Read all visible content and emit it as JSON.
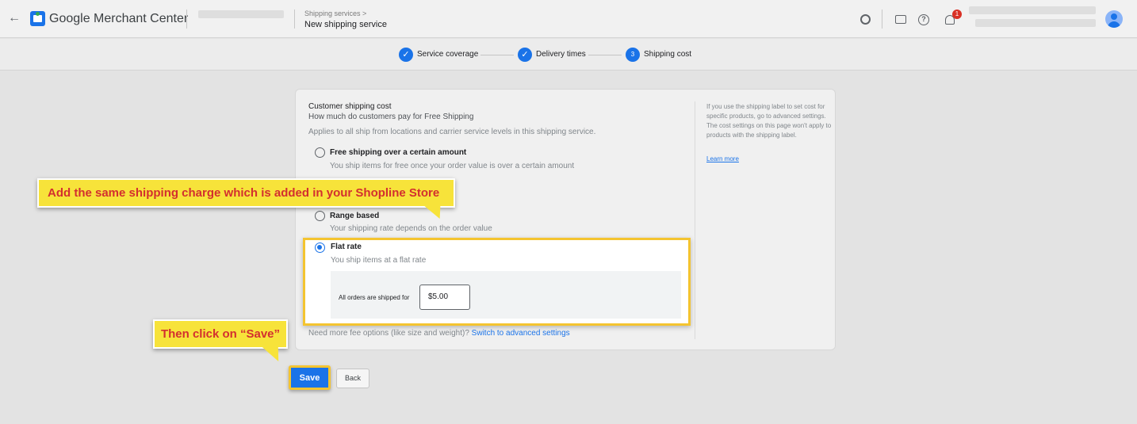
{
  "header": {
    "app_title": "Google Merchant Center",
    "breadcrumb_parent": "Shipping services >",
    "page_title": "New shipping service",
    "notification_count": "1",
    "icons": [
      "back-arrow-icon",
      "merchant-center-logo-icon",
      "settings-gear-icon",
      "mail-icon",
      "help-icon",
      "notifications-bell-icon",
      "account-avatar-icon"
    ]
  },
  "stepper": {
    "steps": [
      {
        "label": "Service coverage",
        "state": "done",
        "marker": "✓"
      },
      {
        "label": "Delivery times",
        "state": "done",
        "marker": "✓"
      },
      {
        "label": "Shipping cost",
        "state": "current",
        "marker": "3"
      }
    ]
  },
  "form": {
    "title": "Customer shipping cost",
    "subtitle": "How much do customers pay for Free Shipping",
    "note": "Applies to all ship from locations and carrier service levels in this shipping service.",
    "options": [
      {
        "label": "Free shipping over a certain amount",
        "description": "You ship items for free once your order value is over a certain amount",
        "selected": false
      },
      {
        "label": "Range based",
        "description": "Your shipping rate depends on the order value",
        "selected": false
      },
      {
        "label": "Flat rate",
        "description": "You ship items at a flat rate",
        "selected": true
      }
    ],
    "flat_rate_prompt": "All orders are shipped for",
    "flat_rate_value": "$5.00",
    "more_fee_text": "Need more fee options (like size and weight)? ",
    "more_fee_link": "Switch to advanced settings"
  },
  "side_note": {
    "text": "If you use the shipping label to set cost for specific products, go to advanced settings. The cost settings on this page won't apply to products with the shipping label.",
    "link": "Learn more"
  },
  "buttons": {
    "save": "Save",
    "back": "Back"
  },
  "callouts": {
    "shipping_charge": "Add the same shipping charge which is added in your Shopline Store",
    "save_hint": "Then click on “Save”"
  },
  "colors": {
    "accent": "#1a73e8",
    "callout_fill": "#f7e33a",
    "callout_text": "#d32f2f",
    "highlight_border": "#f4c430",
    "badge": "#d93025"
  }
}
